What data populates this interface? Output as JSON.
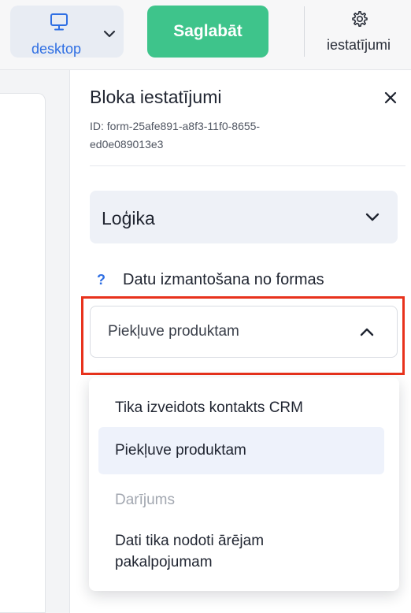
{
  "toolbar": {
    "device_select": {
      "label": "desktop",
      "icon": "monitor-icon"
    },
    "save_label": "Saglabāt",
    "settings": {
      "label": "iestatījumi",
      "icon": "gear-icon"
    }
  },
  "panel": {
    "title": "Bloka iestatījumi",
    "block_id": "ID: form-25afe891-a8f3-11f0-8655-ed0e089013e3",
    "section": {
      "title": "Loģika",
      "expanded": false
    },
    "field": {
      "help_icon": "?",
      "label": "Datu izmantošana no formas",
      "selected_value": "Piekļuve produktam",
      "options": [
        {
          "label": "Tika izveidots kontakts CRM"
        },
        {
          "label": "Piekļuve produktam"
        },
        {
          "label": "Darījums"
        },
        {
          "label": "Dati tika nodoti ārējam pakalpojumam"
        }
      ]
    }
  },
  "colors": {
    "accent_blue": "#2f6fe3",
    "save_green": "#3ec48b",
    "highlight_red": "#e8321c"
  }
}
